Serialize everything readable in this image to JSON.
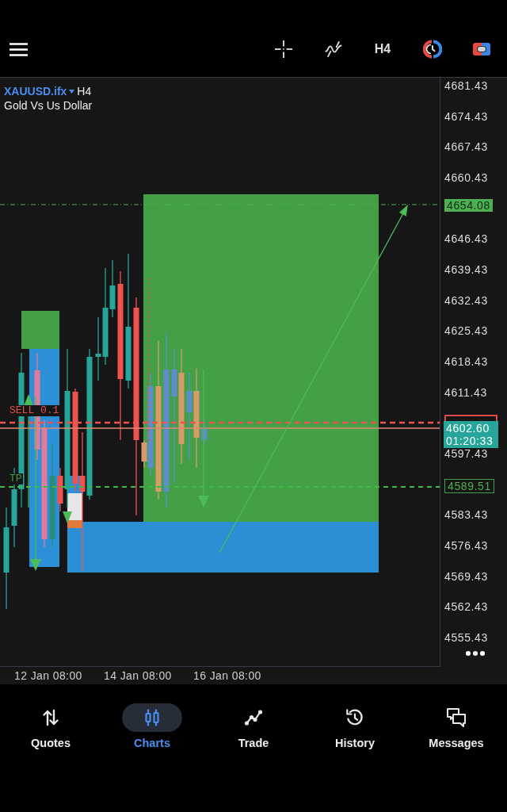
{
  "toolbar": {
    "timeframe": "H4"
  },
  "chart": {
    "symbol": "XAUUSD.ifx",
    "timeframe": "H4",
    "description": "Gold Vs Us Dollar",
    "order_labels": [
      {
        "kind": "sell",
        "text": "SELL 0.1"
      },
      {
        "kind": "tp",
        "text": "TP"
      }
    ]
  },
  "price_axis": {
    "slots": [
      {
        "kind": "tick",
        "text": "4681.43"
      },
      {
        "kind": "tick",
        "text": "4674.43"
      },
      {
        "kind": "tick",
        "text": "4667.43"
      },
      {
        "kind": "tick",
        "text": "4660.43"
      },
      {
        "kind": "tag_filled",
        "text": "4654.08"
      },
      {
        "kind": "tick",
        "text": "4646.43"
      },
      {
        "kind": "tick",
        "text": "4639.43"
      },
      {
        "kind": "tick",
        "text": "4632.43"
      },
      {
        "kind": "tick",
        "text": "4625.43"
      },
      {
        "kind": "tick",
        "text": "4618.43"
      },
      {
        "kind": "tick",
        "text": "4611.43"
      },
      {
        "kind": "live",
        "price": "4602.60",
        "countdown": "01:20:33"
      },
      {
        "kind": "tick",
        "text": "4597.43"
      },
      {
        "kind": "tag_outline",
        "text": "4589.51"
      },
      {
        "kind": "tick",
        "text": "4583.43"
      },
      {
        "kind": "tick",
        "text": "4576.43"
      },
      {
        "kind": "tick",
        "text": "4569.43"
      },
      {
        "kind": "tick",
        "text": "4562.43"
      },
      {
        "kind": "tick",
        "text": "4555.43"
      }
    ]
  },
  "time_axis": {
    "labels": [
      "12 Jan 08:00",
      "14 Jan 08:00",
      "16 Jan 08:00"
    ]
  },
  "nav": {
    "items": [
      {
        "kind": "quotes",
        "label": "Quotes",
        "selected": false
      },
      {
        "kind": "charts",
        "label": "Charts",
        "selected": true
      },
      {
        "kind": "trade",
        "label": "Trade",
        "selected": false
      },
      {
        "kind": "history",
        "label": "History",
        "selected": false
      },
      {
        "kind": "messages",
        "label": "Messages",
        "selected": false
      }
    ]
  }
}
